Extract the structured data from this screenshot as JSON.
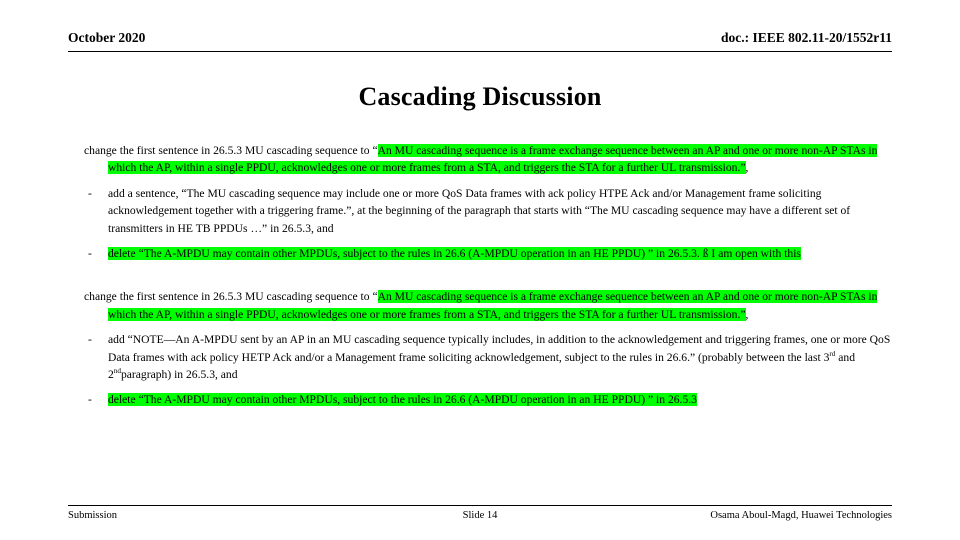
{
  "header": {
    "date": "October 2020",
    "doc": "doc.: IEEE 802.11-20/1552r11"
  },
  "title": "Cascading Discussion",
  "body": {
    "block1": {
      "p1": {
        "lead": "change the first sentence in 26.5.3 MU cascading sequence to “",
        "highlight": "An MU cascading sequence is a frame exchange sequence between an AP and one or more non-AP STAs in which the AP, within a single PPDU, acknowledges one or more frames from a STA, and triggers the STA for a further UL transmission.”",
        "tail": ","
      },
      "b1": {
        "dash": "-",
        "text": "add a sentence, “The MU cascading sequence may include one or more QoS Data frames with ack policy HTPE Ack and/or Management frame soliciting acknowledgement together with a triggering frame.”, at the beginning of the paragraph that starts with “The MU cascading sequence may have a different set of transmitters in HE TB PPDUs …” in 26.5.3, and"
      },
      "b2": {
        "dash": "-",
        "highlight": "delete “The A-MPDU may contain other MPDUs, subject to the rules in 26.6 (A-MPDU operation in an HE PPDU) ” in 26.5.3.  ß I am open with this"
      }
    },
    "block2": {
      "p1": {
        "lead": "change the first sentence in 26.5.3 MU cascading sequence to “",
        "highlight": "An MU cascading sequence is a frame exchange sequence between an AP and one or more non-AP STAs in which the AP, within a single PPDU, acknowledges one or more frames from a STA, and triggers the STA for a further UL transmission.”",
        "tail": ","
      },
      "b1": {
        "dash": "-",
        "text_part1": "add “NOTE—An A-MPDU sent by an AP in an MU cascading sequence typically includes, in addition to the acknowledgement and triggering frames, one or more QoS Data frames with ack policy HETP Ack and/or a Management frame soliciting acknowledgement, subject to the rules in 26.6.” (probably between the last ",
        "sup1": "rd",
        "ord1": "3",
        "text_part2": " and ",
        "ord2": "2",
        "sup2": "nd",
        "text_part3": "paragraph) in 26.5.3, and"
      },
      "b2": {
        "dash": "-",
        "highlight": "delete “The A-MPDU may contain other MPDUs, subject to the rules in 26.6 (A-MPDU operation in an HE PPDU) ” in 26.5.3"
      }
    }
  },
  "footer": {
    "left": "Submission",
    "center": "Slide 14",
    "right": "Osama Aboul-Magd, Huawei Technologies"
  },
  "colors": {
    "highlight": "#00ff00",
    "text": "#000000",
    "background": "#ffffff"
  }
}
